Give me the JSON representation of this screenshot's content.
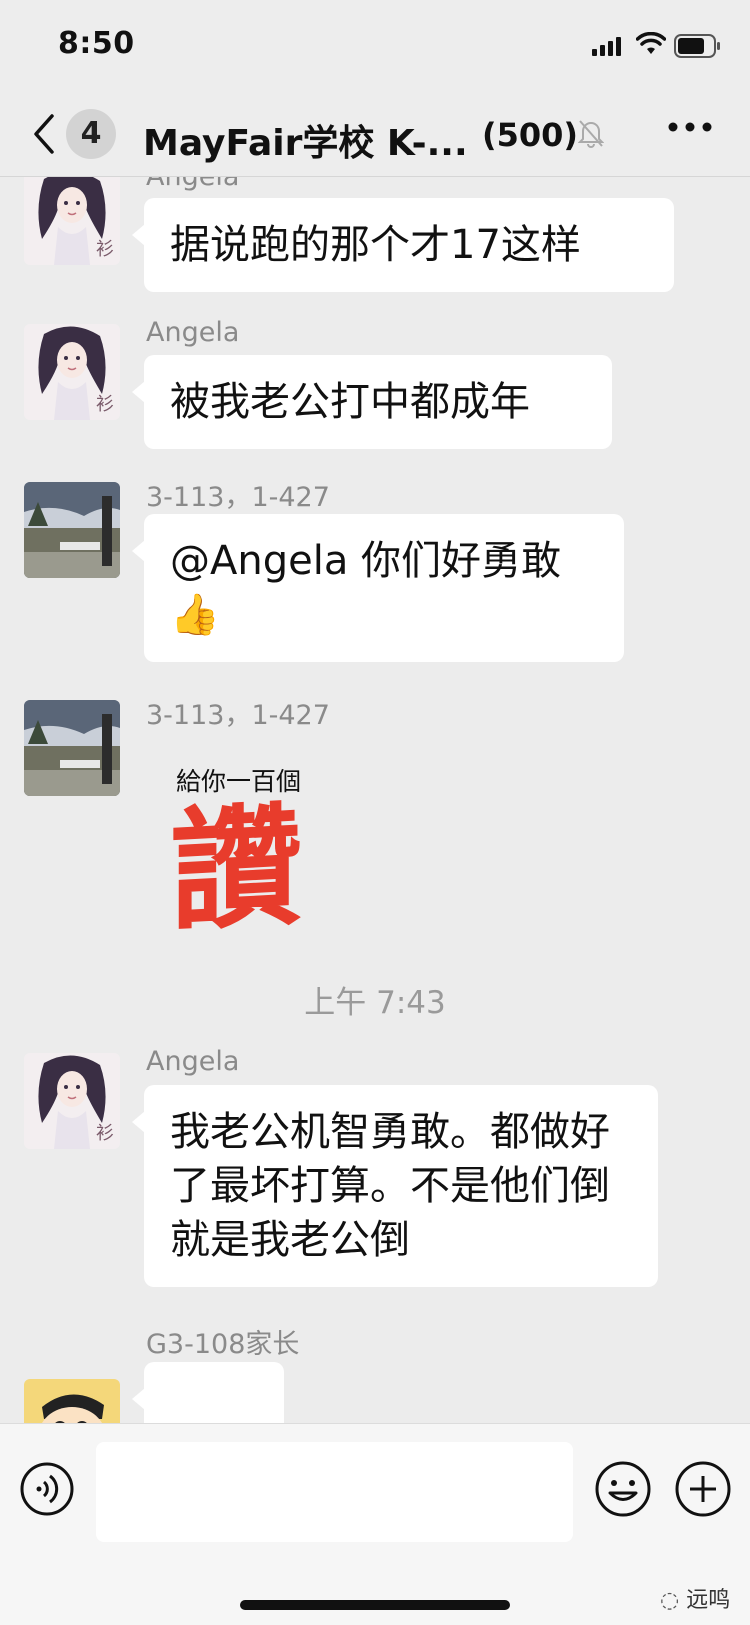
{
  "status_bar": {
    "time": "8:50",
    "signal_icon": "cellular-signal-icon",
    "wifi_icon": "wifi-icon",
    "battery_icon": "battery-icon"
  },
  "nav": {
    "back_icon": "chevron-left-icon",
    "unread_badge": "4",
    "title": "MayFair学校 K-...",
    "member_count": "(500)",
    "mute_icon": "bell-muted-icon",
    "more_icon": "more-dots-icon"
  },
  "messages": [
    {
      "sender": "Angela",
      "text": "据说跑的那个才17这样",
      "avatar": "anime-girl"
    },
    {
      "sender": "Angela",
      "text": "被我老公打中都成年",
      "avatar": "anime-girl"
    },
    {
      "sender": "3-113，1-427",
      "text": "@Angela 你们好勇敢",
      "emoji": "👍",
      "avatar": "street-photo"
    },
    {
      "sender": "3-113，1-427",
      "sticker_small": "給你一百個",
      "sticker_big": "讚",
      "avatar": "street-photo"
    },
    {
      "timestamp": "上午 7:43"
    },
    {
      "sender": "Angela",
      "text": "我老公机智勇敢。都做好了最坏打算。不是他们倒就是我老公倒",
      "avatar": "anime-girl"
    },
    {
      "sender": "G3-108家长",
      "avatar": "cartoon-boy"
    }
  ],
  "input_bar": {
    "voice_icon": "voice-icon",
    "emoji_icon": "emoji-smile-icon",
    "plus_icon": "plus-circle-icon"
  },
  "watermark": "远鸣",
  "colors": {
    "background": "#ececec",
    "bubble": "#ffffff",
    "sticker_red": "#e83c2c"
  }
}
